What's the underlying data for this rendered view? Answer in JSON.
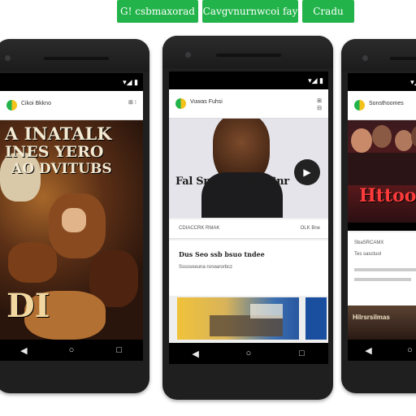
{
  "top_buttons": [
    {
      "label": "G! csbmaxorad "
    },
    {
      "label": "Cavgvnurnwcoi fay"
    },
    {
      "label": "Cradu"
    }
  ],
  "phones": {
    "left": {
      "status_time": "",
      "app_name": "Cikoi Bkkno",
      "poster_line1": "A INATALK",
      "poster_line2": "INES YERO",
      "poster_line3": "AO DVITUBS",
      "poster_bottom": "DI"
    },
    "middle": {
      "status_time": "",
      "app_name": "Vuwas Fuhsi",
      "hero_title": "Fal Snoa nirnhe Snr",
      "card_meta": "CDIACCRK RMAK",
      "card_meta_right": "OLK Bne",
      "card_heading": "Dus Seo ssb bsuo tndee",
      "card_sub": "Sssssoeuna rsnoarorbcz"
    },
    "right": {
      "status_time": "",
      "app_name": "Sonsthoomes",
      "crowd_title": "Httoo",
      "strip_label": "Hilrsrsilmas",
      "card_meta": "SbaSRCAMX",
      "card_heading": "Tes sasctuol"
    }
  },
  "icons": {
    "back": "back-triangle-icon",
    "home": "home-circle-icon",
    "recents": "recents-square-icon"
  },
  "colors": {
    "accent_green": "#22b34a",
    "phone_body": "#1f1f20"
  }
}
